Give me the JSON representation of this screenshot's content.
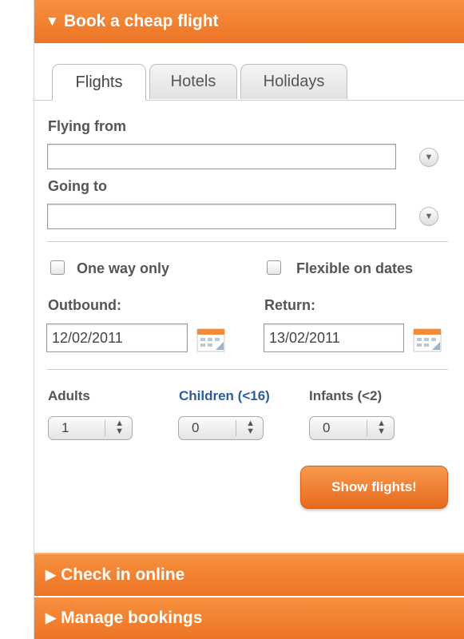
{
  "colors": {
    "accent": "#ec7425",
    "link": "#2a5ea0"
  },
  "header": {
    "title": "Book a cheap flight",
    "arrow": "▼"
  },
  "tabs": [
    {
      "label": "Flights",
      "active": true
    },
    {
      "label": "Hotels",
      "active": false
    },
    {
      "label": "Holidays",
      "active": false
    }
  ],
  "form": {
    "flying_from_label": "Flying from",
    "flying_from_value": "",
    "going_to_label": "Going to",
    "going_to_value": "",
    "one_way_label": "One way only",
    "flexible_label": "Flexible on dates",
    "outbound_label": "Outbound:",
    "outbound_value": "12/02/2011",
    "return_label": "Return:",
    "return_value": "13/02/2011",
    "adults_label": "Adults",
    "adults_value": "1",
    "children_label": "Children (<16)",
    "children_value": "0",
    "infants_label": "Infants (<2)",
    "infants_value": "0",
    "submit_label": "Show flights!"
  },
  "sections": {
    "checkin_label": "Check in online",
    "manage_label": "Manage bookings",
    "arrow": "▶"
  }
}
